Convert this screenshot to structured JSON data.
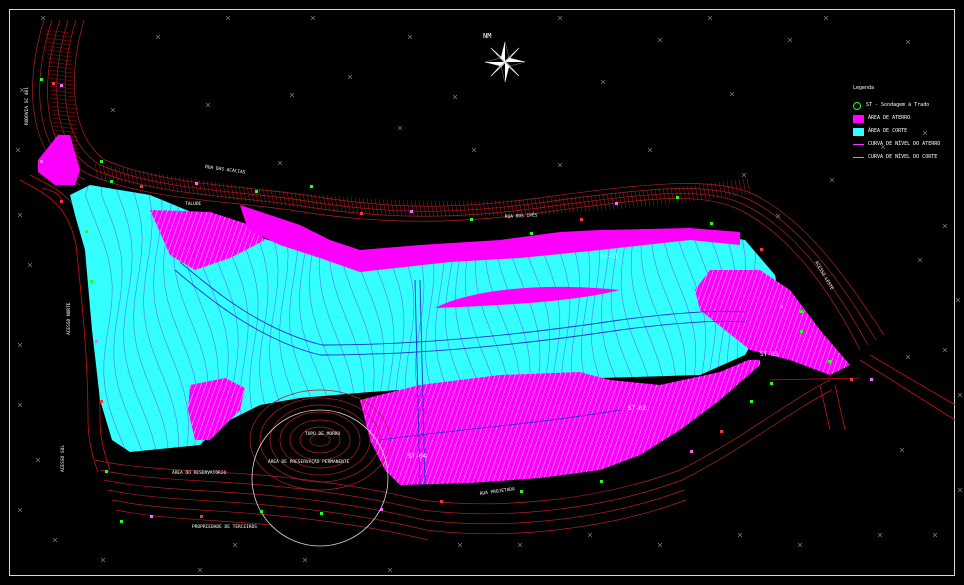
{
  "compass": {
    "label": "NM"
  },
  "legend": {
    "title": "Legenda",
    "items": [
      {
        "kind": "circle",
        "color": "#22ff22",
        "label": "ST - Sondagem à Trado"
      },
      {
        "kind": "fill",
        "color": "#ff00ff",
        "label": "ÁREA DE ATERRO"
      },
      {
        "kind": "fill",
        "color": "#33ffff",
        "label": "ÁREA DE CORTE"
      },
      {
        "kind": "line",
        "color": "#ff33ff",
        "label": "CURVA DE NÍVEL DO ATERRO"
      },
      {
        "kind": "line",
        "color": "#33ccff",
        "label": "CURVA DE NÍVEL DO CORTE"
      }
    ]
  },
  "road_labels": {
    "left_upper": "RODOVIA SC 401",
    "left_middle": "ACESSO NORTE",
    "left_lower": "ACESSO SUL",
    "top_1": "RUA DAS ACÁCIAS",
    "top_2": "RUA DOS IPÊS",
    "right": "ACESSO LESTE",
    "bottom": "RUA PROJETADA"
  },
  "areas": {
    "reservoir": "ÁREA DO RESERVATÓRIO",
    "preservation": "ÁREA DE PRESERVAÇÃO PERMANENTE",
    "hill_top": "TOPO DE MORRO",
    "south": "PROPRIEDADE DE TERCEIROS",
    "upper_left": "TALUDE"
  },
  "points": {
    "st1": "ST-01",
    "st2": "ST-02",
    "st3": "ST-03",
    "st4": "ST-04"
  },
  "colors": {
    "fill_cut": "#33ffff",
    "fill_fill": "#ff00ff",
    "contour_terrain": "#b02020",
    "contour_cut": "#5577ee",
    "contour_fill": "#ffffff",
    "road": "#cc1111"
  }
}
